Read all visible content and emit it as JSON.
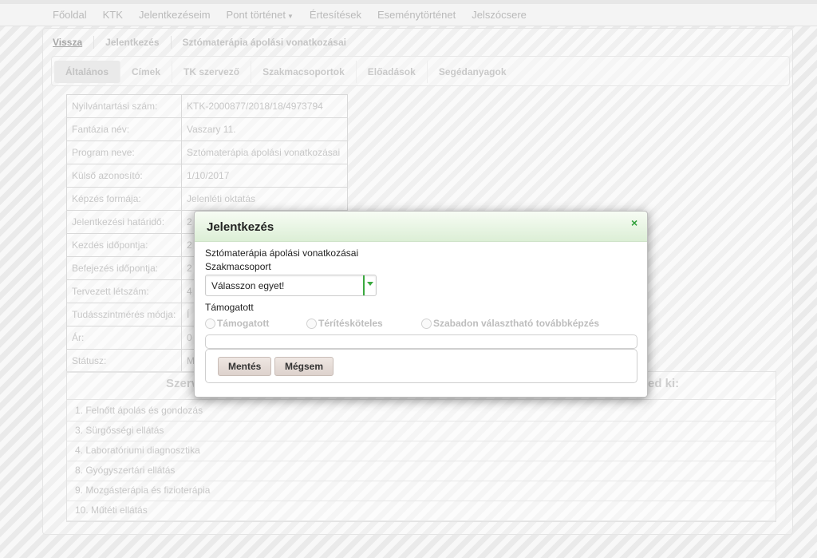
{
  "nav": {
    "items": [
      "Főoldal",
      "KTK",
      "Jelentkezéseim",
      "Pont történet",
      "Értesítések",
      "Eseménytörténet",
      "Jelszócsere"
    ]
  },
  "breadcrumb": {
    "back": "Vissza",
    "level1": "Jelentkezés",
    "current": "Sztómaterápia ápolási vonatkozásai"
  },
  "tabs": [
    "Általános",
    "Címek",
    "TK szervező",
    "Szakmacsoportok",
    "Előadások",
    "Segédanyagok"
  ],
  "info_table": [
    {
      "label": "Nyilvántartási szám:",
      "value": "KTK-2000877/2018/18/4973794"
    },
    {
      "label": "Fantázia név:",
      "value": "Vaszary 11."
    },
    {
      "label": "Program neve:",
      "value": "Sztómaterápia ápolási vonatkozásai"
    },
    {
      "label": "Külső azonosító:",
      "value": "1/10/2017"
    },
    {
      "label": "Képzés formája:",
      "value": "Jelenléti oktatás"
    },
    {
      "label": "Jelentkezési határidő:",
      "value": "2"
    },
    {
      "label": "Kezdés időpontja:",
      "value": "2"
    },
    {
      "label": "Befejezés időpontja:",
      "value": "2"
    },
    {
      "label": "Tervezett létszám:",
      "value": "4"
    },
    {
      "label": "Tudásszintmérés módja:",
      "value": "Í"
    },
    {
      "label": "Ár:",
      "value": "0"
    },
    {
      "label": "Státusz:",
      "value": "M"
    }
  ],
  "szakmacsoport": {
    "title_left": "Szerv",
    "title_right": "ed ki:",
    "items": [
      "1. Felnőtt ápolás és gondozás",
      "3. Sürgősségi ellátás",
      "4. Laboratóriumi diagnosztika",
      "8. Gyógyszertári ellátás",
      "9. Mozgásterápia és fizioterápia",
      "10. Műtéti ellátás"
    ]
  },
  "dialog": {
    "title": "Jelentkezés",
    "close_symbol": "×",
    "program": "Sztómaterápia ápolási vonatkozásai",
    "szakmacsoport_label": "Szakmacsoport",
    "select_value": "Válasszon egyet!",
    "tamogatott_label": "Támogatott",
    "radio_options": [
      "Támogatott",
      "Térítésköteles",
      "Szabadon választható továbbképzés"
    ],
    "save_label": "Mentés",
    "cancel_label": "Mégsem"
  },
  "colors": {
    "dialog_header": "#dcefd6",
    "accent_green": "#3aa93f",
    "button_bg": "#e6dcd7"
  }
}
